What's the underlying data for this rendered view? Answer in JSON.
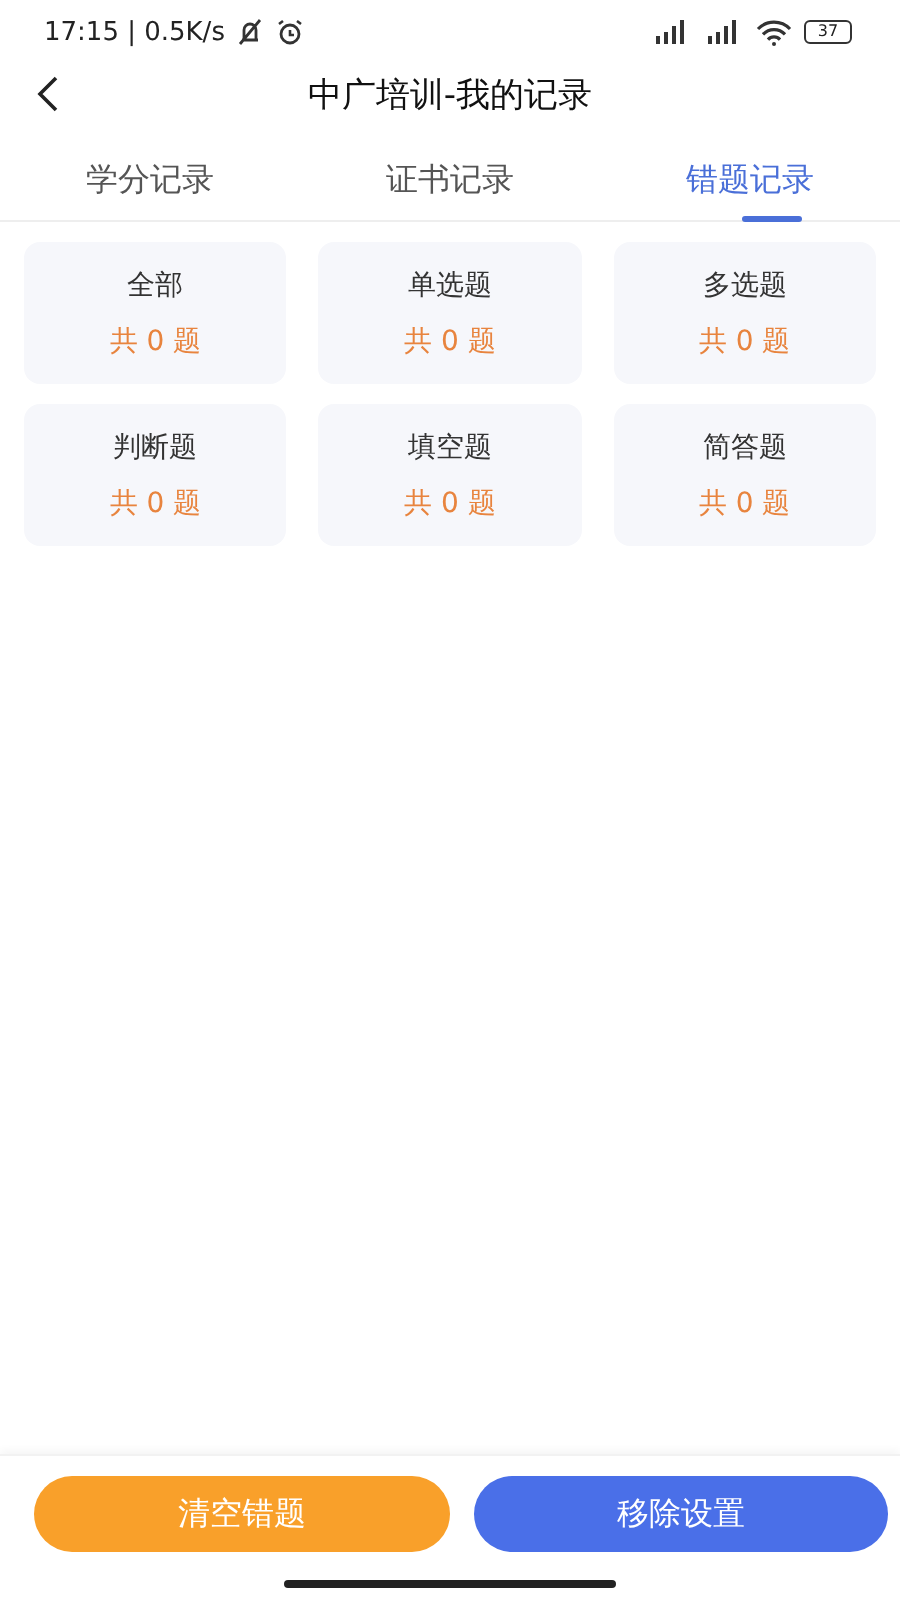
{
  "status_bar": {
    "time_speed": "17:15 | 0.5K/s",
    "battery": "37"
  },
  "header": {
    "title": "中广培训-我的记录"
  },
  "tabs": [
    {
      "label": "学分记录",
      "selected": false
    },
    {
      "label": "证书记录",
      "selected": false
    },
    {
      "label": "错题记录",
      "selected": true
    }
  ],
  "categories": [
    {
      "name": "全部",
      "count": "共 0 题"
    },
    {
      "name": "单选题",
      "count": "共 0 题"
    },
    {
      "name": "多选题",
      "count": "共 0 题"
    },
    {
      "name": "判断题",
      "count": "共 0 题"
    },
    {
      "name": "填空题",
      "count": "共 0 题"
    },
    {
      "name": "简答题",
      "count": "共 0 题"
    }
  ],
  "actions": [
    {
      "label": "清空错题",
      "kind": "warning"
    },
    {
      "label": "移除设置",
      "kind": "primary"
    }
  ]
}
